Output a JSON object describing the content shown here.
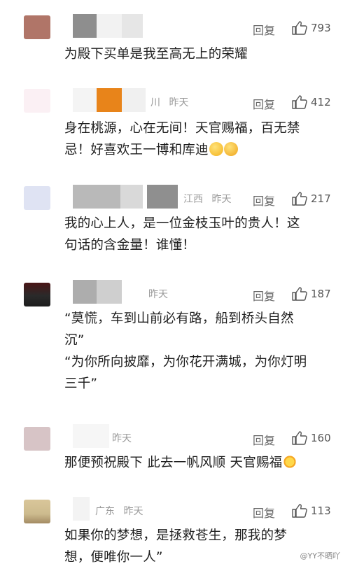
{
  "reply_label": "回复",
  "comments": [
    {
      "location": "",
      "time": "",
      "likes": "793",
      "lines": [
        "为殿下买单是我至高无上的荣耀"
      ]
    },
    {
      "location": "川",
      "time": "昨天",
      "likes": "412",
      "lines": [
        "身在桃源，心在无间！天官赐福，百无禁",
        "忌！好喜欢王一博和库迪"
      ],
      "emojis": [
        "grin-emoji",
        "thinking-emoji"
      ]
    },
    {
      "location": "江西",
      "time": "昨天",
      "likes": "217",
      "lines": [
        "我的心上人，是一位金枝玉叶的贵人！这",
        "句话的含金量！谁懂！"
      ]
    },
    {
      "location": "",
      "time": "昨天",
      "likes": "187",
      "lines": [
        "“莫慌，车到山前必有路，船到桥头自然",
        "沉”",
        "“为你所向披靡，为你花开满城，为你灯明",
        "三千”"
      ]
    },
    {
      "location": "",
      "time": "昨天",
      "likes": "160",
      "lines": [
        "那便预祝殿下 此去一帆风顺 天官赐福"
      ],
      "emojis": [
        "sun-emoji"
      ]
    },
    {
      "location": "广东",
      "time": "昨天",
      "likes": "113",
      "lines": [
        "如果你的梦想，是拯救苍生，那我的梦",
        "想，便唯你一人”"
      ]
    }
  ],
  "watermark": "@YY不晒吖",
  "colors": {
    "accent_orange": "#e8841a",
    "text": "#1e1e1e",
    "meta": "#9a9a9a"
  }
}
